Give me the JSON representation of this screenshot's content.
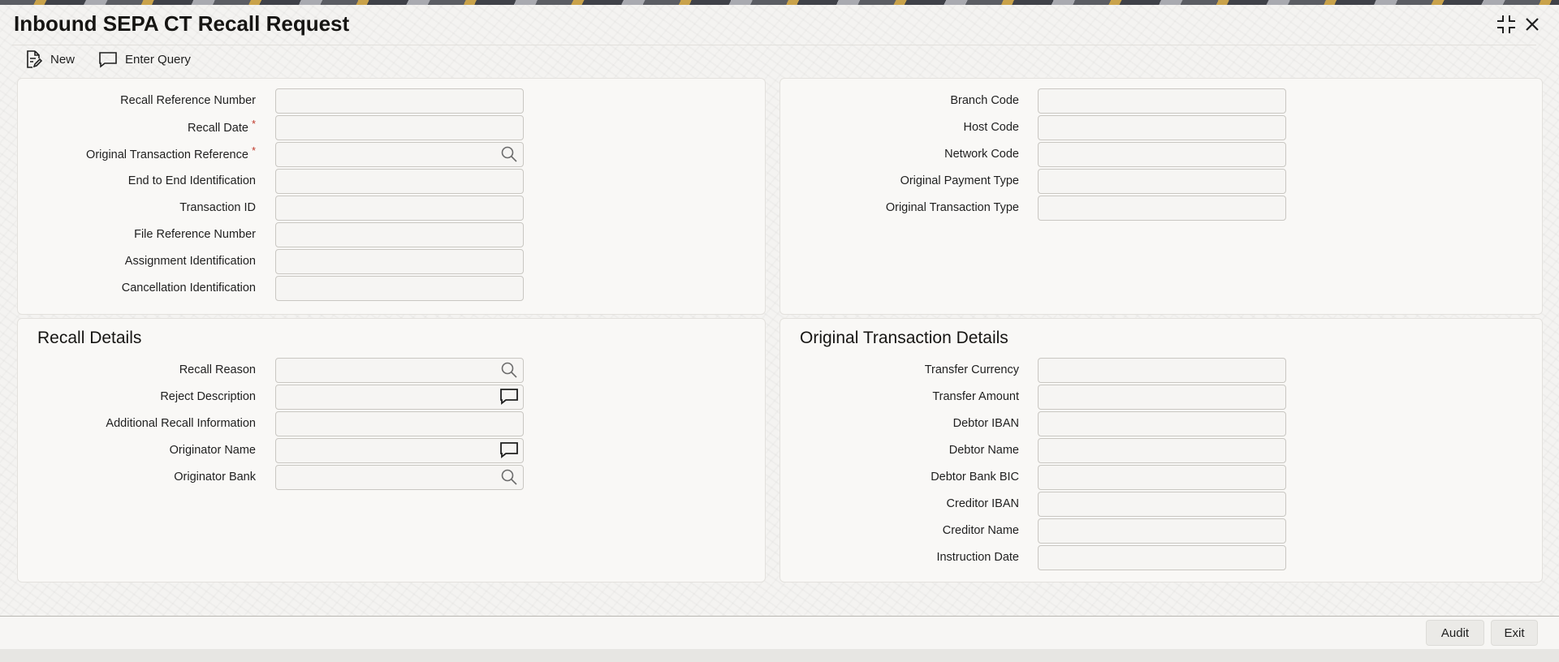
{
  "window": {
    "title": "Inbound SEPA CT Recall Request"
  },
  "toolbar": {
    "new_label": "New",
    "enter_query_label": "Enter Query"
  },
  "main_left": {
    "fields": [
      {
        "label": "Recall Reference Number",
        "value": "",
        "required": false
      },
      {
        "label": "Recall Date",
        "value": "",
        "required": true
      },
      {
        "label": "Original Transaction Reference",
        "value": "",
        "required": true,
        "icon": "search-icon"
      },
      {
        "label": "End to End Identification",
        "value": "",
        "required": false
      },
      {
        "label": "Transaction ID",
        "value": "",
        "required": false
      },
      {
        "label": "File Reference Number",
        "value": "",
        "required": false
      },
      {
        "label": "Assignment Identification",
        "value": "",
        "required": false
      },
      {
        "label": "Cancellation Identification",
        "value": "",
        "required": false
      }
    ]
  },
  "main_right": {
    "fields": [
      {
        "label": "Branch Code",
        "value": ""
      },
      {
        "label": "Host Code",
        "value": ""
      },
      {
        "label": "Network Code",
        "value": ""
      },
      {
        "label": "Original Payment Type",
        "value": ""
      },
      {
        "label": "Original Transaction Type",
        "value": ""
      }
    ]
  },
  "recall_details": {
    "heading": "Recall Details",
    "fields": [
      {
        "label": "Recall Reason",
        "value": "",
        "icon": "search-icon"
      },
      {
        "label": "Reject Description",
        "value": "",
        "icon": "comment-icon"
      },
      {
        "label": "Additional Recall Information",
        "value": ""
      },
      {
        "label": "Originator Name",
        "value": "",
        "icon": "comment-icon"
      },
      {
        "label": "Originator Bank",
        "value": "",
        "icon": "search-icon"
      }
    ]
  },
  "original_transaction_details": {
    "heading": "Original Transaction Details",
    "fields": [
      {
        "label": "Transfer Currency",
        "value": ""
      },
      {
        "label": "Transfer Amount",
        "value": ""
      },
      {
        "label": "Debtor IBAN",
        "value": ""
      },
      {
        "label": "Debtor Name",
        "value": ""
      },
      {
        "label": "Debtor Bank BIC",
        "value": ""
      },
      {
        "label": "Creditor IBAN",
        "value": ""
      },
      {
        "label": "Creditor Name",
        "value": ""
      },
      {
        "label": "Instruction Date",
        "value": ""
      }
    ]
  },
  "footer": {
    "audit_label": "Audit",
    "exit_label": "Exit"
  }
}
